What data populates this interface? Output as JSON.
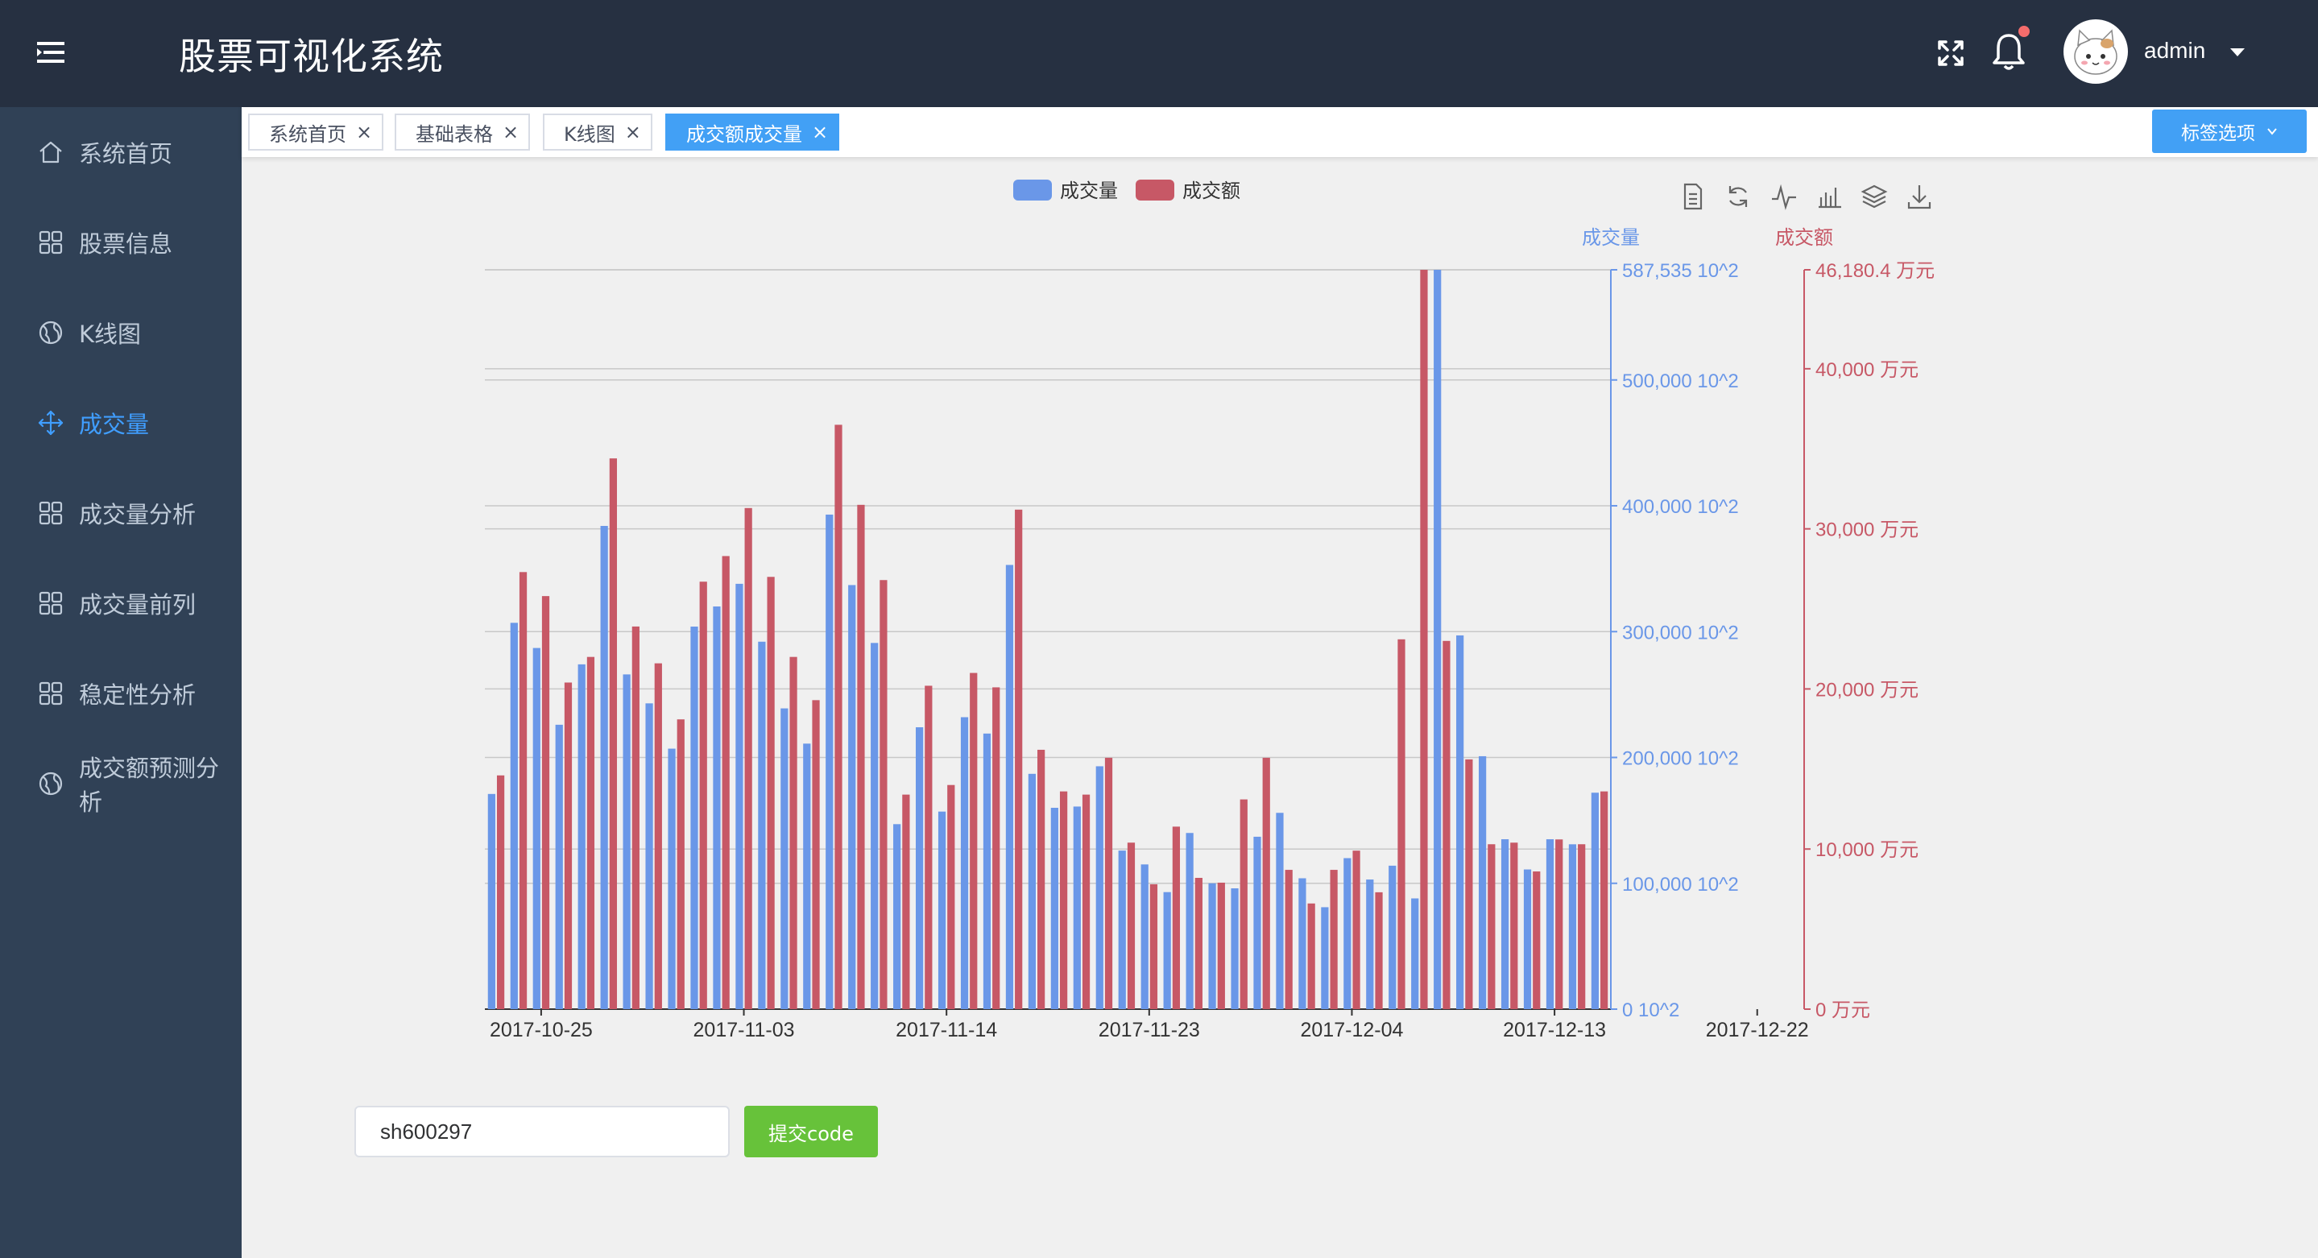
{
  "app": {
    "title": "股票可视化系统"
  },
  "user": {
    "name": "admin"
  },
  "sidebar": {
    "items": [
      {
        "label": "系统首页",
        "icon": "home-icon"
      },
      {
        "label": "股票信息",
        "icon": "grid-icon"
      },
      {
        "label": "K线图",
        "icon": "globe-icon"
      },
      {
        "label": "成交量",
        "icon": "move-icon",
        "active": true
      },
      {
        "label": "成交量分析",
        "icon": "grid-icon"
      },
      {
        "label": "成交量前列",
        "icon": "grid-icon"
      },
      {
        "label": "稳定性分析",
        "icon": "grid-icon"
      },
      {
        "label": "成交额预测分析",
        "icon": "globe-icon"
      }
    ]
  },
  "tags": {
    "items": [
      {
        "label": "系统首页"
      },
      {
        "label": "基础表格"
      },
      {
        "label": "K线图"
      },
      {
        "label": "成交额成交量",
        "active": true
      }
    ],
    "options_label": "标签选项"
  },
  "form": {
    "code_value": "sh600297",
    "submit_label": "提交code"
  },
  "colors": {
    "volume": "#6a97e8",
    "amount": "#c75866",
    "active": "#409eff",
    "sidebar": "#304156",
    "header": "#263041"
  },
  "chart_data": {
    "type": "bar",
    "legend": [
      "成交量",
      "成交额"
    ],
    "legend_position": "top-center",
    "toolbox_icons": [
      "data-view-icon",
      "restore-icon",
      "line-type-icon",
      "bar-type-icon",
      "stack-icon",
      "download-icon"
    ],
    "x_tick_labels": [
      "2017-10-25",
      "2017-11-03",
      "2017-11-14",
      "2017-11-23",
      "2017-12-04",
      "2017-12-13",
      "2017-12-22"
    ],
    "y_axes": [
      {
        "name": "成交量",
        "unit": "10^2",
        "min": 0,
        "max": 587535,
        "tick_labels": [
          "0 10^2",
          "100,000 10^2",
          "200,000 10^2",
          "300,000 10^2",
          "400,000 10^2",
          "500,000 10^2",
          "587,535 10^2"
        ],
        "ticks": [
          0,
          100000,
          200000,
          300000,
          400000,
          500000,
          587535
        ]
      },
      {
        "name": "成交额",
        "unit": "万元",
        "min": 0,
        "max": 46180.4,
        "tick_labels": [
          "0 万元",
          "10,000 万元",
          "20,000 万元",
          "30,000 万元",
          "40,000 万元",
          "46,180.4 万元"
        ],
        "ticks": [
          0,
          10000,
          20000,
          30000,
          40000,
          46180.4
        ]
      }
    ],
    "grid": true,
    "series": [
      {
        "name": "成交量",
        "axis": 0,
        "values": [
          171000,
          307000,
          287000,
          226000,
          274000,
          384000,
          266000,
          243000,
          207000,
          304000,
          320000,
          338000,
          292000,
          239000,
          211000,
          393000,
          337000,
          291000,
          147000,
          224000,
          157000,
          232000,
          219000,
          353000,
          187000,
          160000,
          161000,
          193000,
          126000,
          115000,
          93000,
          140000,
          100000,
          96000,
          137000,
          156000,
          104000,
          81000,
          120000,
          103000,
          114000,
          88000,
          587535,
          297000,
          201000,
          135000,
          111000,
          135000,
          131000,
          172000
        ]
      },
      {
        "name": "成交额",
        "axis": 1,
        "values": [
          14600,
          27300,
          25800,
          20400,
          22000,
          34400,
          23900,
          21600,
          18100,
          26700,
          28300,
          31300,
          27000,
          22000,
          19300,
          36500,
          31500,
          26800,
          13400,
          20200,
          14000,
          21000,
          20100,
          31200,
          16200,
          13600,
          13400,
          15700,
          10400,
          7800,
          11400,
          8200,
          7900,
          13100,
          15700,
          8700,
          6600,
          8700,
          9900,
          7300,
          23100,
          46180.4,
          23000,
          15600,
          10300,
          10400,
          8600,
          10600,
          10300,
          13600
        ]
      }
    ]
  }
}
